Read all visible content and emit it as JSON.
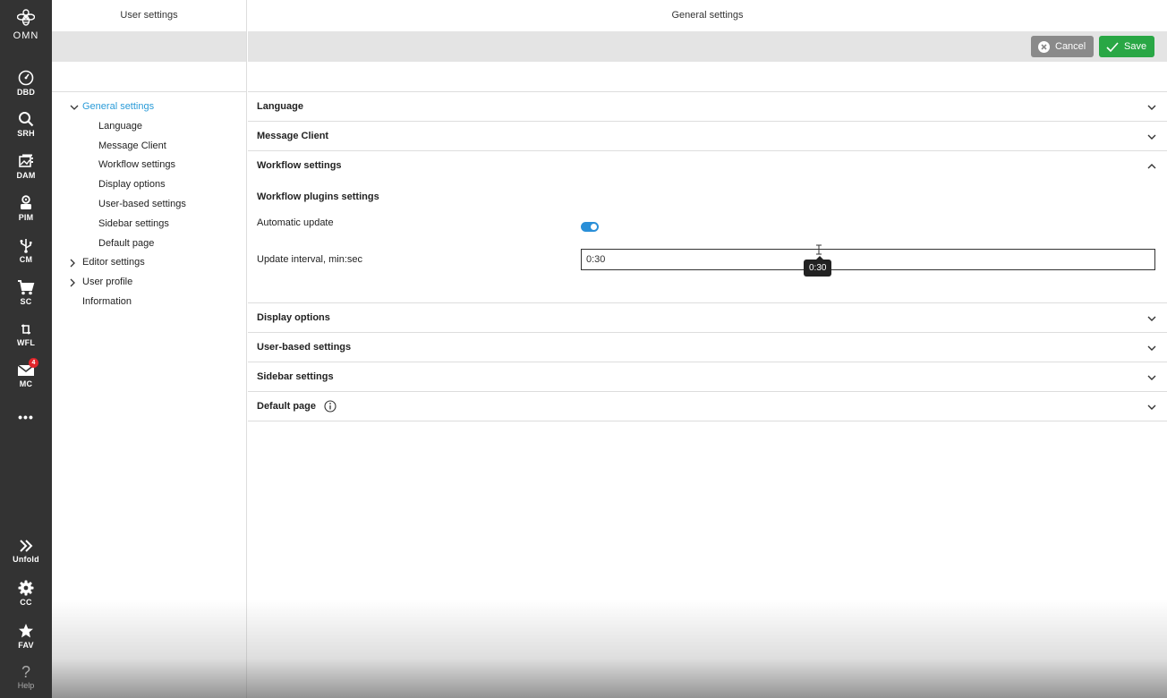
{
  "rail": {
    "logo": "OMN",
    "items": [
      {
        "label": "DBD",
        "icon": "dashboard-icon"
      },
      {
        "label": "SRH",
        "icon": "search-icon"
      },
      {
        "label": "DAM",
        "icon": "image-gallery-icon"
      },
      {
        "label": "PIM",
        "icon": "product-icon"
      },
      {
        "label": "CM",
        "icon": "usb-icon"
      },
      {
        "label": "SC",
        "icon": "cart-icon"
      },
      {
        "label": "WFL",
        "icon": "workflow-icon"
      },
      {
        "label": "MC",
        "icon": "mail-icon",
        "badge": "4"
      }
    ],
    "more": "•••",
    "bottom": [
      {
        "label": "Unfold",
        "icon": "double-chevron-right-icon"
      },
      {
        "label": "CC",
        "icon": "gear-icon"
      },
      {
        "label": "FAV",
        "icon": "star-icon"
      },
      {
        "label": "Help",
        "icon": "help-icon"
      }
    ]
  },
  "left_panel": {
    "title": "User settings",
    "tree": [
      {
        "label": "General settings",
        "expanded": true,
        "active": true
      },
      {
        "label": "Language",
        "child": true
      },
      {
        "label": "Message Client",
        "child": true
      },
      {
        "label": "Workflow settings",
        "child": true
      },
      {
        "label": "Display options",
        "child": true
      },
      {
        "label": "User-based settings",
        "child": true
      },
      {
        "label": "Sidebar settings",
        "child": true
      },
      {
        "label": "Default page",
        "child": true
      },
      {
        "label": "Editor settings",
        "expandable": true
      },
      {
        "label": "User profile",
        "expandable": true
      },
      {
        "label": "Information"
      }
    ]
  },
  "main": {
    "title": "General settings",
    "cancel_label": "Cancel",
    "save_label": "Save",
    "sections": {
      "language": "Language",
      "message_client": "Message Client",
      "workflow": "Workflow settings",
      "display": "Display options",
      "user_based": "User-based settings",
      "sidebar": "Sidebar settings",
      "default_page": "Default page"
    },
    "workflow_body": {
      "subtitle": "Workflow plugins settings",
      "auto_update_label": "Automatic update",
      "auto_update_on": true,
      "interval_label": "Update interval, min:sec",
      "interval_value": "0:30",
      "tooltip": "0:30"
    }
  },
  "colors": {
    "rail_bg": "#333333",
    "accent_blue": "#2a9bd8",
    "save_green": "#29a745",
    "cancel_gray": "#8a8a8a",
    "badge_red": "#e0262b"
  }
}
